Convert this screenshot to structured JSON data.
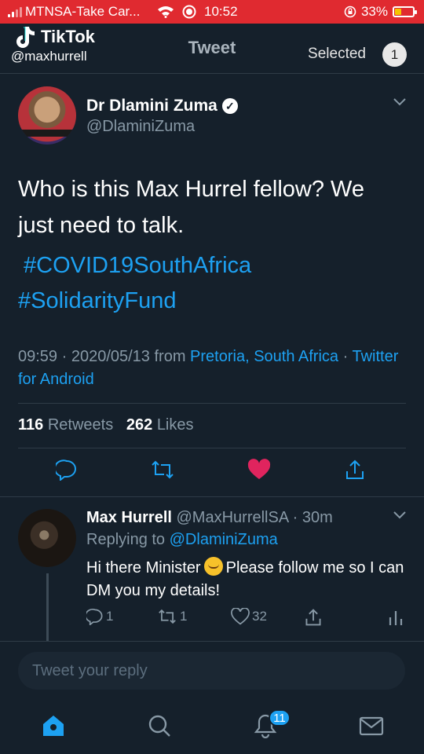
{
  "status_bar": {
    "carrier": "MTNSA-Take Car...",
    "time": "10:52",
    "battery_percent": "33%",
    "battery_level": 0.33,
    "battery_color": "#f5c400",
    "bar_color": "#e02a30"
  },
  "overlay": {
    "app_name": "TikTok",
    "handle": "@maxhurrell"
  },
  "header": {
    "title": "Tweet",
    "selected_label": "Selected",
    "selected_count": "1"
  },
  "tweet": {
    "author_name": "Dr Dlamini Zuma",
    "author_handle": "@DlaminiZuma",
    "text": "Who is this Max Hurrel fellow? We just need to talk.",
    "hashtags": [
      "#COVID19SouthAfrica",
      "#SolidarityFund"
    ],
    "timestamp": "09:59 · 2020/05/13 from ",
    "location": "Pretoria, South Africa",
    "separator": " · ",
    "client": "Twitter for Android",
    "retweets_count": "116",
    "retweets_label": "Retweets",
    "likes_count": "262",
    "likes_label": "Likes",
    "accent_color": "#1da1f2",
    "like_color": "#e0245e"
  },
  "reply": {
    "author_name": "Max Hurrell",
    "author_handle": "@MaxHurrellSA",
    "time_ago": " · 30m",
    "replying_prefix": "Replying to ",
    "replying_to": "@DlaminiZuma",
    "text_before_emoji": "Hi there Minister",
    "text_after_emoji": "Please follow me so I can DM you my details!",
    "reply_count": "1",
    "retweet_count": "1",
    "like_count": "32"
  },
  "compose": {
    "placeholder": "Tweet your reply"
  },
  "bottom_nav": {
    "items": [
      "home-icon",
      "search-icon",
      "bell-icon",
      "mail-icon"
    ],
    "notification_count": "11"
  }
}
